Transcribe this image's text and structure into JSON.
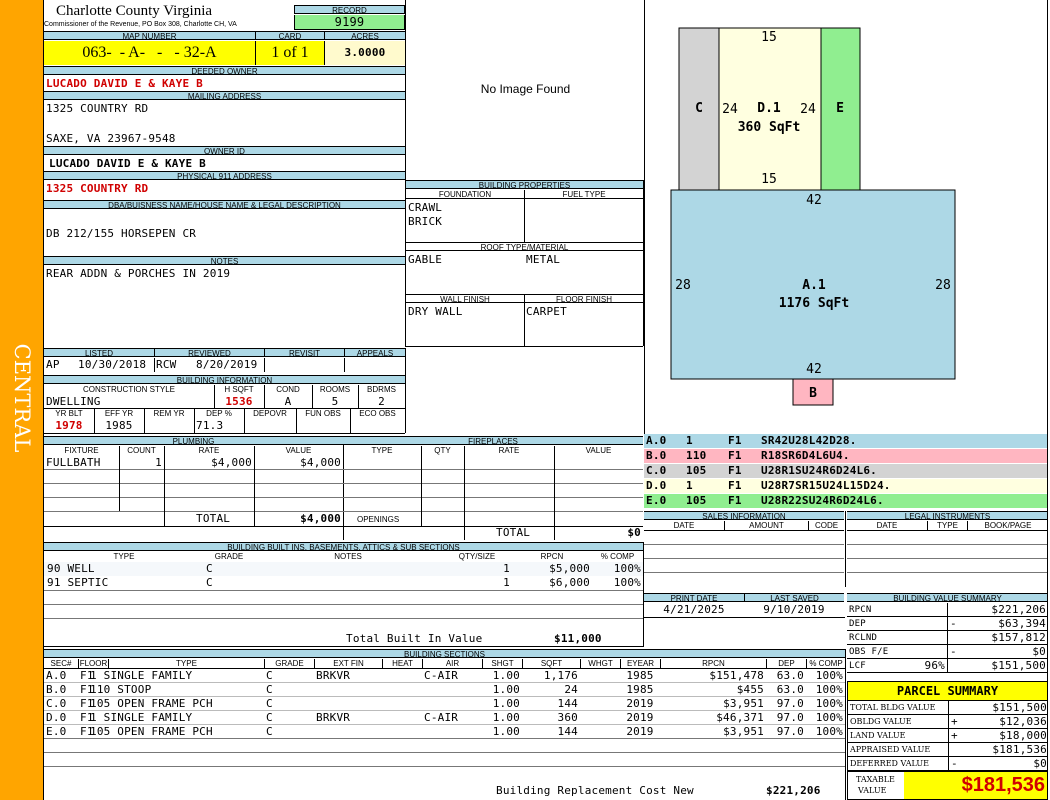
{
  "sidebar_label": "CENTRAL",
  "header": {
    "county": "Charlotte County Virginia",
    "subtitle": "Commissioner of the Revenue, PO Box 308, Charlotte CH, VA",
    "record_label": "RECORD",
    "record": "9199"
  },
  "parcel": {
    "map_label": "MAP NUMBER",
    "map_number": "063-  - A-   -   - 32-A",
    "card_label": "CARD",
    "card": "1 of 1",
    "acres_label": "ACRES",
    "acres": "3.0000"
  },
  "owner": {
    "deeded_label": "DEEDED OWNER",
    "deeded": "LUCADO DAVID E & KAYE B",
    "mailing_label": "MAILING ADDRESS",
    "mail1": "1325 COUNTRY RD",
    "mail2": "SAXE, VA 23967-9548",
    "ownerid_label": "OWNER ID",
    "owner_id": "LUCADO DAVID E & KAYE B",
    "phys_label": "PHYSICAL 911 ADDRESS",
    "physical": "1325 COUNTRY RD"
  },
  "dba": {
    "label": "DBA/BUISNESS NAME/HOUSE NAME & LEGAL DESCRIPTION",
    "text": "DB 212/155 HORSEPEN CR"
  },
  "notes": {
    "label": "NOTES",
    "text": "REAR ADDN & PORCHES IN 2019"
  },
  "image_text": "No Image Found",
  "building_props": {
    "label": "BUILDING PROPERTIES",
    "foundation_label": "FOUNDATION",
    "fuel_label": "FUEL TYPE",
    "found1": "CRAWL",
    "found2": "BRICK",
    "roof_label": "ROOF TYPE/MATERIAL",
    "roof_type": "GABLE",
    "roof_mat": "METAL",
    "wall_label": "WALL FINISH",
    "floor_label": "FLOOR FINISH",
    "wall": "DRY WALL",
    "floor": "CARPET"
  },
  "listing": {
    "listed_label": "LISTED",
    "reviewed_label": "REVIEWED",
    "revisit_label": "REVISIT",
    "appeals_label": "APPEALS",
    "listed_by": "AP",
    "listed_date": "10/30/2018",
    "reviewed_by": "RCW",
    "reviewed_date": "8/20/2019"
  },
  "building_info": {
    "label": "BUILDING INFORMATION",
    "cs_label": "CONSTRUCTION STYLE",
    "hsqft_label": "H SQFT",
    "cond_label": "COND",
    "rooms_label": "ROOMS",
    "bdrms_label": "BDRMS",
    "style": "DWELLING",
    "hsqft": "1536",
    "cond": "A",
    "rooms": "5",
    "bdrms": "2",
    "yrblt_label": "YR BLT",
    "effyr_label": "EFF YR",
    "remyr_label": "REM YR",
    "dep_label": "DEP %",
    "depovr_label": "DEPOVR",
    "funobs_label": "FUN OBS",
    "ecoobs_label": "ECO OBS",
    "yrblt": "1978",
    "effyr": "1985",
    "dep": "71.3"
  },
  "plumbing": {
    "label": "PLUMBING",
    "h_fixture": "FIXTURE",
    "h_count": "COUNT",
    "h_rate": "RATE",
    "h_value": "VALUE",
    "rows": [
      {
        "fixture": "FULLBATH",
        "count": "1",
        "rate": "$4,000",
        "value": "$4,000"
      }
    ],
    "total_label": "TOTAL",
    "total": "$4,000"
  },
  "fireplaces": {
    "label": "FIREPLACES",
    "h_type": "TYPE",
    "h_qty": "QTY",
    "h_rate": "RATE",
    "h_value": "VALUE",
    "openings_label": "OPENINGS",
    "total_label": "TOTAL",
    "total": "$0"
  },
  "builtins": {
    "label": "BUILDING BUILT INS, BASEMENTS, ATTICS & SUB SECTIONS",
    "h_type": "TYPE",
    "h_grade": "GRADE",
    "h_notes": "NOTES",
    "h_qty": "QTY/SIZE",
    "h_rpcn": "RPCN",
    "h_comp": "% COMP",
    "rows": [
      {
        "type": "90 WELL",
        "grade": "C",
        "qty": "1",
        "rpcn": "$5,000",
        "comp": "100%"
      },
      {
        "type": "91 SEPTIC",
        "grade": "C",
        "qty": "1",
        "rpcn": "$6,000",
        "comp": "100%"
      }
    ],
    "total_label": "Total Built In Value",
    "total": "$11,000"
  },
  "sections": {
    "label": "BUILDING SECTIONS",
    "headers": [
      "SEC#",
      "FLOOR",
      "TYPE",
      "GRADE",
      "EXT FIN",
      "HEAT",
      "AIR",
      "SHGT",
      "SQFT",
      "WHGT",
      "EYEAR",
      "RPCN",
      "DEP",
      "% COMP"
    ],
    "rows": [
      {
        "sec": "A.0",
        "floor": "F1",
        "type": "1 SINGLE FAMILY",
        "grade": "C",
        "ext": "BRKVR",
        "heat": "",
        "air": "C-AIR",
        "shgt": "1.00",
        "sqft": "1,176",
        "whgt": "",
        "eyear": "1985",
        "rpcn": "$151,478",
        "dep": "63.0",
        "comp": "100%"
      },
      {
        "sec": "B.0",
        "floor": "F1",
        "type": "110 STOOP",
        "grade": "C",
        "ext": "",
        "heat": "",
        "air": "",
        "shgt": "1.00",
        "sqft": "24",
        "whgt": "",
        "eyear": "1985",
        "rpcn": "$455",
        "dep": "63.0",
        "comp": "100%"
      },
      {
        "sec": "C.0",
        "floor": "F1",
        "type": "105 OPEN FRAME PCH",
        "grade": "C",
        "ext": "",
        "heat": "",
        "air": "",
        "shgt": "1.00",
        "sqft": "144",
        "whgt": "",
        "eyear": "2019",
        "rpcn": "$3,951",
        "dep": "97.0",
        "comp": "100%"
      },
      {
        "sec": "D.0",
        "floor": "F1",
        "type": "1 SINGLE FAMILY",
        "grade": "C",
        "ext": "BRKVR",
        "heat": "",
        "air": "C-AIR",
        "shgt": "1.00",
        "sqft": "360",
        "whgt": "",
        "eyear": "2019",
        "rpcn": "$46,371",
        "dep": "97.0",
        "comp": "100%"
      },
      {
        "sec": "E.0",
        "floor": "F1",
        "type": "105 OPEN FRAME PCH",
        "grade": "C",
        "ext": "",
        "heat": "",
        "air": "",
        "shgt": "1.00",
        "sqft": "144",
        "whgt": "",
        "eyear": "2019",
        "rpcn": "$3,951",
        "dep": "97.0",
        "comp": "100%"
      }
    ],
    "total_label": "Building Replacement Cost New",
    "total": "$221,206"
  },
  "sketch": {
    "labels": {
      "c": "C",
      "d_top": "15",
      "d_left": "24",
      "d_right": "24",
      "d_bottom": "15",
      "d_name": "D.1",
      "d_area": "360 SqFt",
      "e": "E",
      "a_top": "42",
      "a_left": "28",
      "a_right": "28",
      "a_bottom": "42",
      "a_name": "A.1",
      "a_area": "1176 SqFt",
      "b": "B"
    },
    "colors": {
      "a": "#add8e6",
      "b": "#ffb6c1",
      "c": "#d3d3d3",
      "d": "#ffffe0",
      "e": "#90ee90"
    },
    "legend": [
      {
        "sec": "A.0",
        "n": "1",
        "f": "F1",
        "path": "SR42U28L42D28.",
        "color": "#add8e6"
      },
      {
        "sec": "B.0",
        "n": "110",
        "f": "F1",
        "path": "R18SR6D4L6U4.",
        "color": "#ffb6c1"
      },
      {
        "sec": "C.0",
        "n": "105",
        "f": "F1",
        "path": "U28R1SU24R6D24L6.",
        "color": "#d3d3d3"
      },
      {
        "sec": "D.0",
        "n": "1",
        "f": "F1",
        "path": "U28R7SR15U24L15D24.",
        "color": "#ffffe0"
      },
      {
        "sec": "E.0",
        "n": "105",
        "f": "F1",
        "path": "U28R22SU24R6D24L6.",
        "color": "#90ee90"
      }
    ]
  },
  "sales": {
    "label": "SALES INFORMATION",
    "h_date": "DATE",
    "h_amount": "AMOUNT",
    "h_code": "CODE"
  },
  "legal": {
    "label": "LEGAL INSTRUMENTS",
    "h_date": "DATE",
    "h_type": "TYPE",
    "h_book": "BOOK/PAGE"
  },
  "dates": {
    "print_label": "PRINT DATE",
    "saved_label": "LAST SAVED",
    "print_date": "4/21/2025",
    "saved_date": "9/10/2019"
  },
  "value_summary": {
    "label": "BUILDING VALUE SUMMARY",
    "rows": [
      {
        "label": "RPCN",
        "sign": "",
        "pct": "",
        "value": "$221,206"
      },
      {
        "label": "DEP",
        "sign": "-",
        "pct": "",
        "value": "$63,394"
      },
      {
        "label": "RCLND",
        "sign": "",
        "pct": "",
        "value": "$157,812"
      },
      {
        "label": "OBS F/E",
        "sign": "-",
        "pct": "",
        "value": "$0"
      },
      {
        "label": "LCF",
        "sign": "",
        "pct": "96%",
        "value": "$151,500"
      }
    ]
  },
  "parcel_summary": {
    "label": "PARCEL SUMMARY",
    "rows": [
      {
        "label": "TOTAL BLDG VALUE",
        "sign": "",
        "value": "$151,500"
      },
      {
        "label": "OBLDG VALUE",
        "sign": "+",
        "value": "$12,036"
      },
      {
        "label": "LAND VALUE",
        "sign": "+",
        "value": "$18,000"
      },
      {
        "label": "APPRAISED VALUE",
        "sign": "",
        "value": "$181,536"
      },
      {
        "label": "DEFERRED VALUE",
        "sign": "-",
        "value": "$0"
      }
    ],
    "taxable_label1": "TAXABLE",
    "taxable_label2": "VALUE",
    "taxable": "$181,536"
  }
}
